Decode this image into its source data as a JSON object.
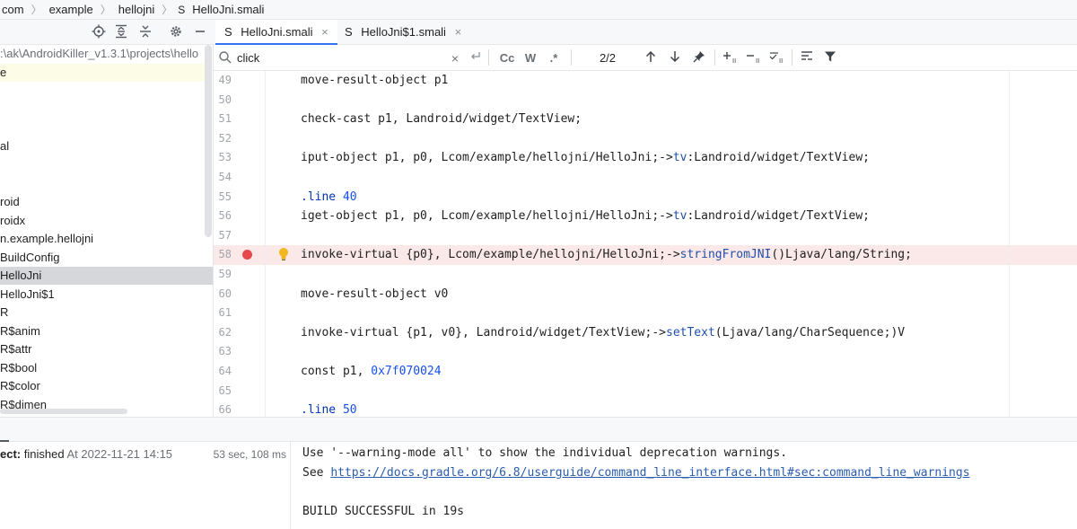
{
  "breadcrumb": {
    "items": [
      "com",
      "example",
      "hellojni"
    ],
    "file_prefix": "S",
    "file": "HelloJni.smali"
  },
  "project": {
    "path": ":\\ak\\AndroidKiller_v1.3.1\\projects\\hello",
    "items": [
      "e",
      "al",
      "roid",
      "roidx",
      "n.example.hellojni",
      "BuildConfig",
      "HelloJni",
      "HelloJni$1",
      "R",
      "R$anim",
      "R$attr",
      "R$bool",
      "R$color",
      "R$dimen"
    ]
  },
  "tabs": [
    {
      "prefix": "S",
      "label": "HelloJni.smali",
      "close": "×"
    },
    {
      "prefix": "S",
      "label": "HelloJni$1.smali",
      "close": "×"
    }
  ],
  "search": {
    "value": "click",
    "toggles": [
      "Cc",
      "W",
      ".*"
    ],
    "match_count": "2/2"
  },
  "editor": {
    "lines": [
      {
        "n": "49",
        "segs": [
          [
            "plain",
            "move-result-object p1"
          ]
        ]
      },
      {
        "n": "50",
        "segs": []
      },
      {
        "n": "51",
        "segs": [
          [
            "plain",
            "check-cast p1, Landroid/widget/TextView;"
          ]
        ]
      },
      {
        "n": "52",
        "segs": []
      },
      {
        "n": "53",
        "segs": [
          [
            "plain",
            "iput-object p1, p0, Lcom/example/hellojni/HelloJni;->"
          ],
          [
            "ref",
            "tv"
          ],
          [
            "plain",
            ":Landroid/widget/TextView;"
          ]
        ]
      },
      {
        "n": "54",
        "segs": []
      },
      {
        "n": "55",
        "segs": [
          [
            "dir",
            ".line "
          ],
          [
            "num",
            "40"
          ]
        ]
      },
      {
        "n": "56",
        "segs": [
          [
            "plain",
            "iget-object p1, p0, Lcom/example/hellojni/HelloJni;->"
          ],
          [
            "ref",
            "tv"
          ],
          [
            "plain",
            ":Landroid/widget/TextView;"
          ]
        ]
      },
      {
        "n": "57",
        "segs": []
      },
      {
        "n": "58",
        "segs": [
          [
            "plain",
            "invoke-virtual {p0}, Lcom/example/hellojni/HelloJni;->"
          ],
          [
            "meth",
            "stringFromJNI"
          ],
          [
            "plain",
            "()Ljava/lang/String;"
          ]
        ],
        "breakpoint": true,
        "bulb": true
      },
      {
        "n": "59",
        "segs": []
      },
      {
        "n": "60",
        "segs": [
          [
            "plain",
            "move-result-object v0"
          ]
        ]
      },
      {
        "n": "61",
        "segs": []
      },
      {
        "n": "62",
        "segs": [
          [
            "plain",
            "invoke-virtual {p1, v0}, Landroid/widget/TextView;->"
          ],
          [
            "meth",
            "setText"
          ],
          [
            "plain",
            "(Ljava/lang/CharSequence;)V"
          ]
        ]
      },
      {
        "n": "63",
        "segs": []
      },
      {
        "n": "64",
        "segs": [
          [
            "plain",
            "const p1, "
          ],
          [
            "num",
            "0x7f070024"
          ]
        ]
      },
      {
        "n": "65",
        "segs": []
      },
      {
        "n": "66",
        "segs": [
          [
            "dir",
            ".line "
          ],
          [
            "num",
            "50"
          ]
        ]
      }
    ]
  },
  "build": {
    "label": "ect:",
    "status": "finished",
    "at": "At 2022-11-21 14:15",
    "duration": "53 sec, 108 ms",
    "output": {
      "line1": "Use '--warning-mode all' to show the individual deprecation warnings.",
      "line2_prefix": "See ",
      "line2_link": "https://docs.gradle.org/6.8/userguide/command_line_interface.html#sec:command_line_warnings",
      "line3": "BUILD SUCCESSFUL in 19s"
    }
  },
  "colors": {
    "accent": "#3574f0",
    "breakpoint": "#e5484d",
    "selection": "#d5d7db"
  }
}
